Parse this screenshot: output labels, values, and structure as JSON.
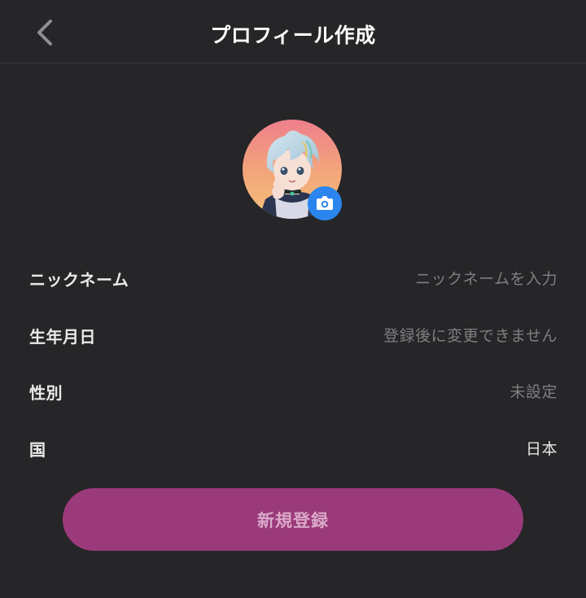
{
  "header": {
    "title": "プロフィール作成",
    "back_icon": "chevron-left-icon"
  },
  "avatar": {
    "icon": "camera-icon",
    "badge_color": "#2a86ee"
  },
  "form": {
    "rows": [
      {
        "label": "ニックネーム",
        "value": "ニックネームを入力"
      },
      {
        "label": "生年月日",
        "value": "登録後に変更できません"
      },
      {
        "label": "性別",
        "value": "未設定"
      },
      {
        "label": "国",
        "value": "日本"
      }
    ]
  },
  "actions": {
    "register_label": "新規登録",
    "register_color": "#9b3a7b"
  },
  "colors": {
    "background": "#262527",
    "accent": "#9b3a7b"
  }
}
